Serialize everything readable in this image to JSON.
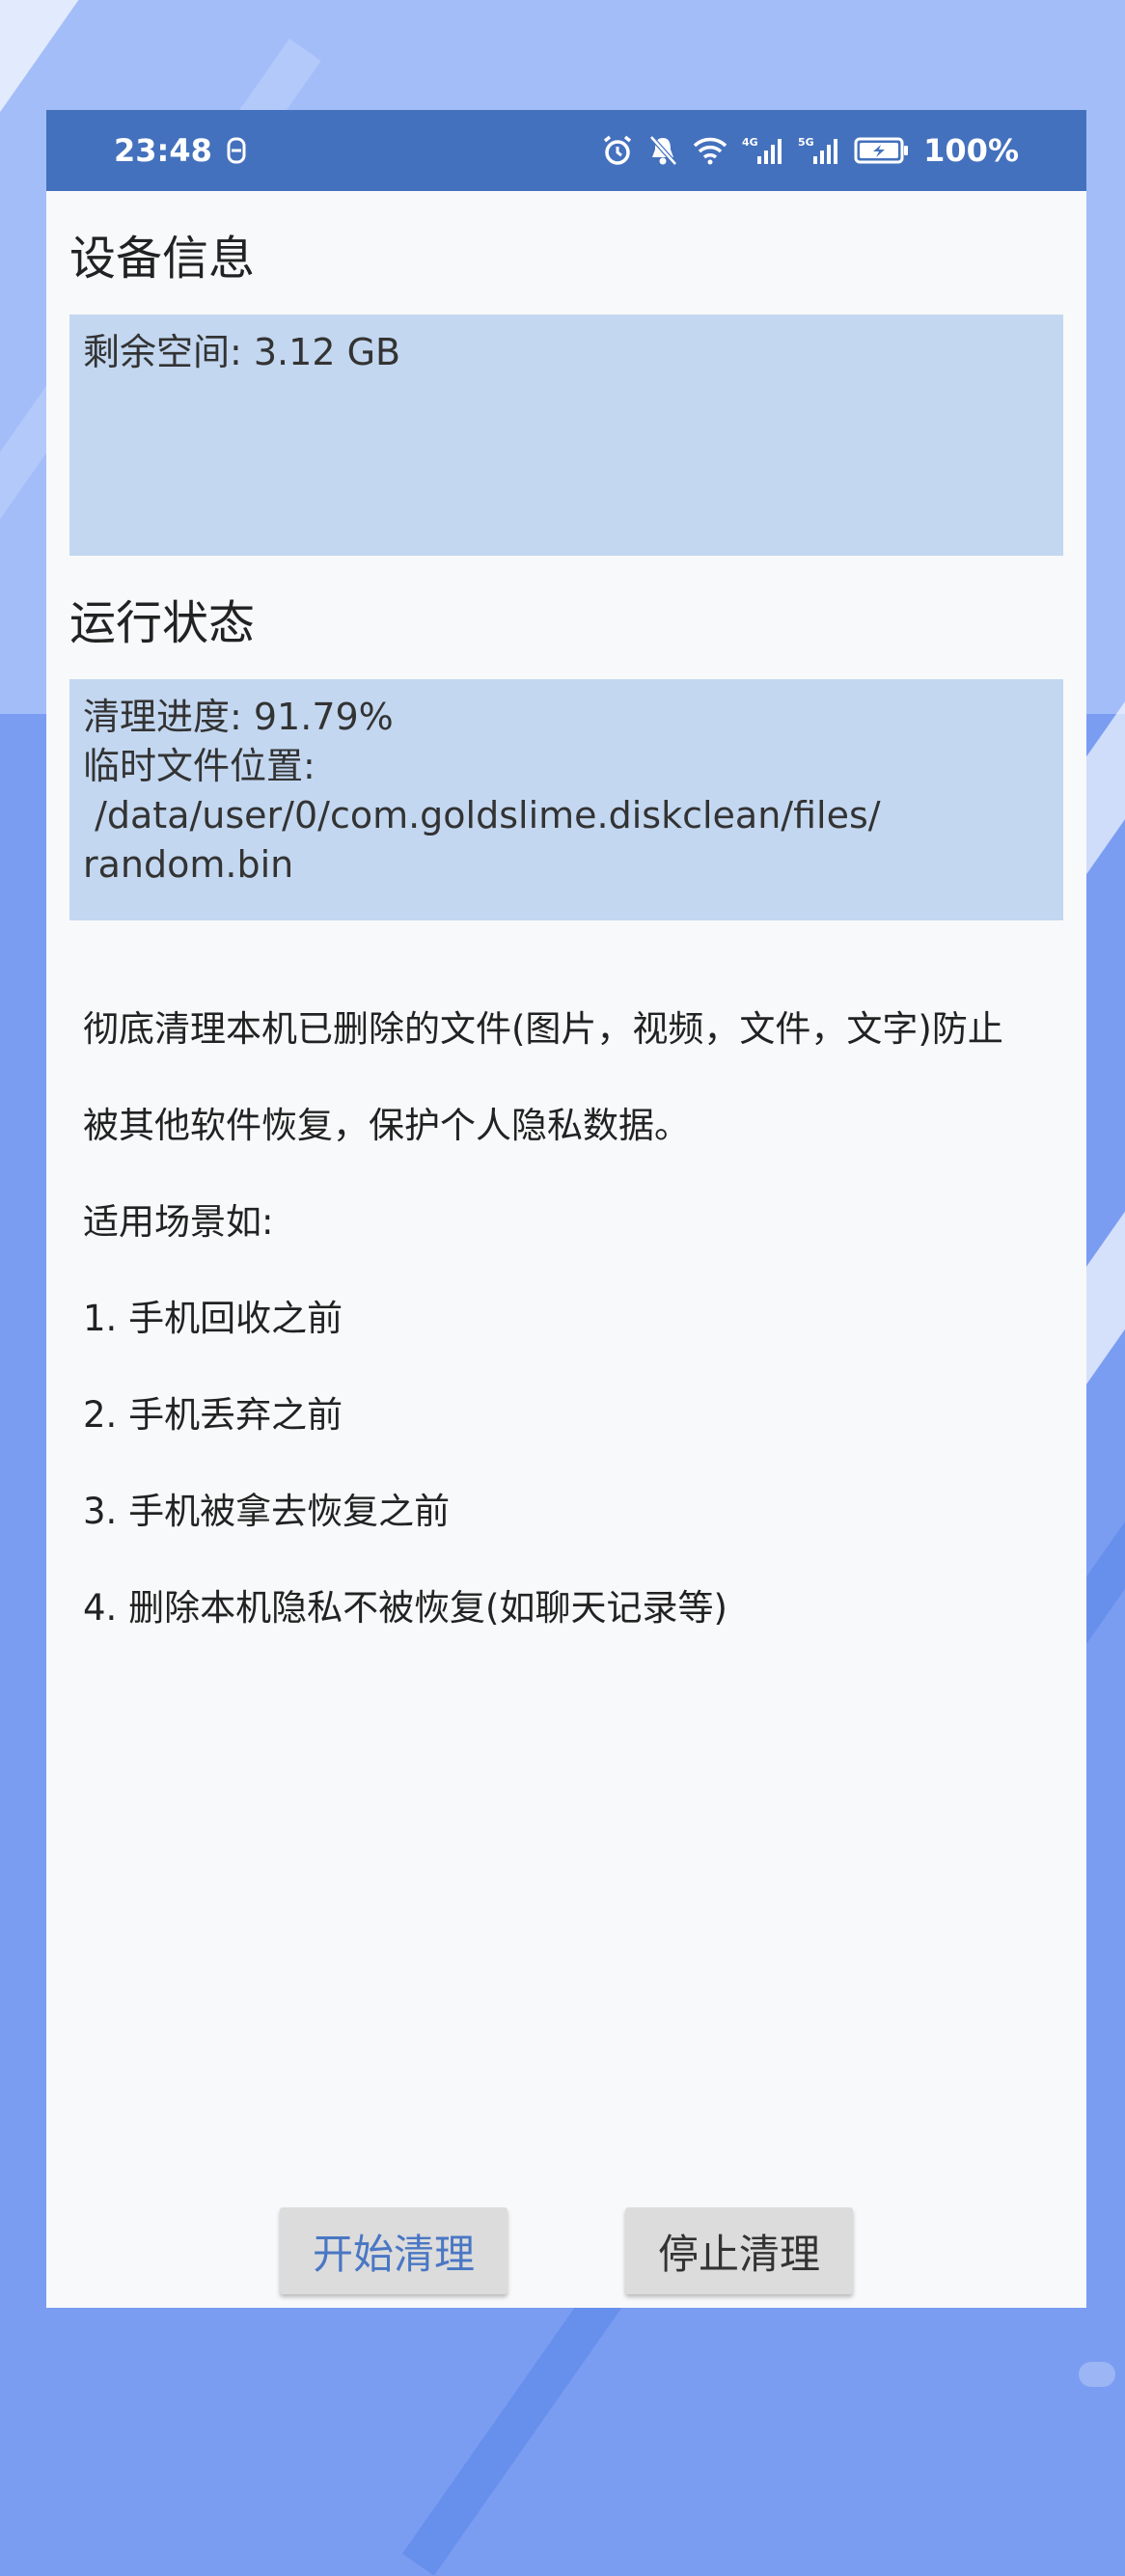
{
  "status_bar": {
    "time": "23:48",
    "battery": "100%",
    "network_4g": "4G",
    "network_5g": "5G"
  },
  "device_info": {
    "title": "设备信息",
    "free_space": "剩余空间: 3.12 GB"
  },
  "run_status": {
    "title": "运行状态",
    "progress": "清理进度: 91.79%",
    "temp_label": "临时文件位置:",
    "temp_path": " /data/user/0/com.goldslime.diskclean/files/",
    "temp_file": "random.bin"
  },
  "description": {
    "line1": "彻底清理本机已删除的文件(图片，视频，文件，文字)防止",
    "line2": "被其他软件恢复，保护个人隐私数据。",
    "line3": "适用场景如:",
    "item1": "1. 手机回收之前",
    "item2": "2. 手机丢弃之前",
    "item3": "3. 手机被拿去恢复之前",
    "item4": "4. 删除本机隐私不被恢复(如聊天记录等)"
  },
  "buttons": {
    "start": "开始清理",
    "stop": "停止清理"
  },
  "colors": {
    "status_bar": "#4471bd",
    "info_box": "#c3d7f0",
    "start_text": "#4a77c4"
  }
}
